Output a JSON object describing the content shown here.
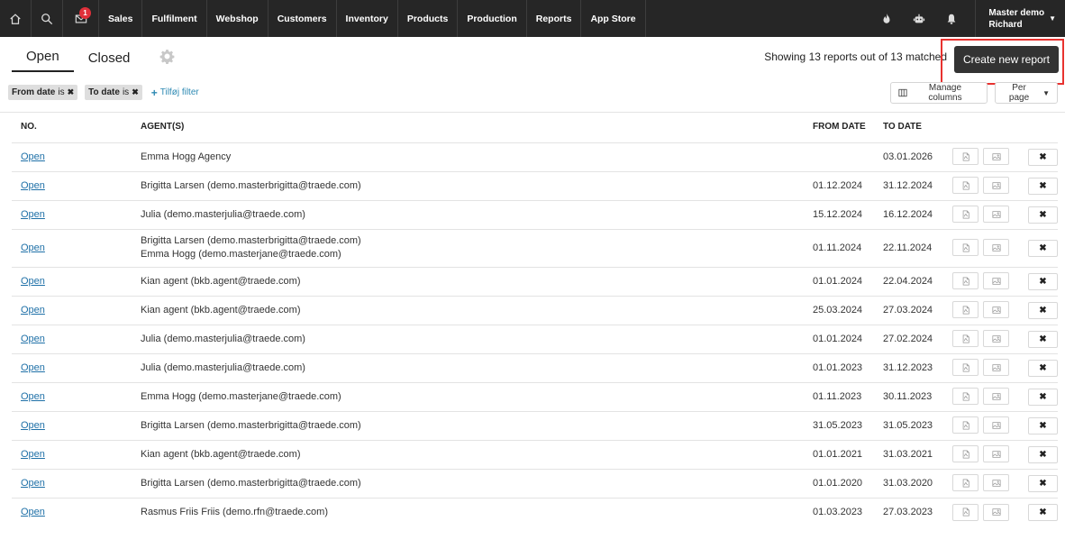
{
  "nav": {
    "mail_badge": "1",
    "links": [
      "Sales",
      "Fulfilment",
      "Webshop",
      "Customers",
      "Inventory",
      "Products",
      "Production",
      "Reports",
      "App Store"
    ],
    "user_line1": "Master demo",
    "user_line2": "Richard"
  },
  "tabs": {
    "open": "Open",
    "closed": "Closed"
  },
  "summary": "Showing 13 reports out of 13 matched",
  "create_button": "Create new report",
  "filters": {
    "chip1_name": "From date",
    "chip1_op": "is",
    "chip2_name": "To date",
    "chip2_op": "is",
    "add_filter": "Tilføj filter"
  },
  "toolbar": {
    "manage_columns": "Manage columns",
    "per_page": "Per page"
  },
  "table": {
    "headers": {
      "no": "NO.",
      "agents": "AGENT(S)",
      "from": "FROM DATE",
      "to": "TO DATE"
    },
    "rows": [
      {
        "link": "Open",
        "agents": [
          "Emma Hogg Agency"
        ],
        "from": "",
        "to": "03.01.2026"
      },
      {
        "link": "Open",
        "agents": [
          "Brigitta Larsen (demo.masterbrigitta@traede.com)"
        ],
        "from": "01.12.2024",
        "to": "31.12.2024"
      },
      {
        "link": "Open",
        "agents": [
          "Julia (demo.masterjulia@traede.com)"
        ],
        "from": "15.12.2024",
        "to": "16.12.2024"
      },
      {
        "link": "Open",
        "agents": [
          "Brigitta Larsen (demo.masterbrigitta@traede.com)",
          "Emma Hogg (demo.masterjane@traede.com)"
        ],
        "from": "01.11.2024",
        "to": "22.11.2024"
      },
      {
        "link": "Open",
        "agents": [
          "Kian agent (bkb.agent@traede.com)"
        ],
        "from": "01.01.2024",
        "to": "22.04.2024"
      },
      {
        "link": "Open",
        "agents": [
          "Kian agent (bkb.agent@traede.com)"
        ],
        "from": "25.03.2024",
        "to": "27.03.2024"
      },
      {
        "link": "Open",
        "agents": [
          "Julia (demo.masterjulia@traede.com)"
        ],
        "from": "01.01.2024",
        "to": "27.02.2024"
      },
      {
        "link": "Open",
        "agents": [
          "Julia (demo.masterjulia@traede.com)"
        ],
        "from": "01.01.2023",
        "to": "31.12.2023"
      },
      {
        "link": "Open",
        "agents": [
          "Emma Hogg (demo.masterjane@traede.com)"
        ],
        "from": "01.11.2023",
        "to": "30.11.2023"
      },
      {
        "link": "Open",
        "agents": [
          "Brigitta Larsen (demo.masterbrigitta@traede.com)"
        ],
        "from": "31.05.2023",
        "to": "31.05.2023"
      },
      {
        "link": "Open",
        "agents": [
          "Kian agent (bkb.agent@traede.com)"
        ],
        "from": "01.01.2021",
        "to": "31.03.2021"
      },
      {
        "link": "Open",
        "agents": [
          "Brigitta Larsen (demo.masterbrigitta@traede.com)"
        ],
        "from": "01.01.2020",
        "to": "31.03.2020"
      },
      {
        "link": "Open",
        "agents": [
          "Rasmus Friis Friis (demo.rfn@traede.com)"
        ],
        "from": "01.03.2023",
        "to": "27.03.2023"
      }
    ]
  },
  "icons": {
    "home": "home-icon",
    "search": "search-icon",
    "mail": "mail-icon",
    "fire": "fire-icon",
    "robot": "robot-icon",
    "bell": "bell-icon",
    "gear": "gear-icon",
    "pdf": "pdf-icon",
    "image": "image-icon",
    "close": "close-icon"
  },
  "colors": {
    "navbar": "#262626",
    "link": "#2071a8",
    "badge": "#e0303a",
    "highlight": "#e8322f",
    "button": "#333333"
  }
}
